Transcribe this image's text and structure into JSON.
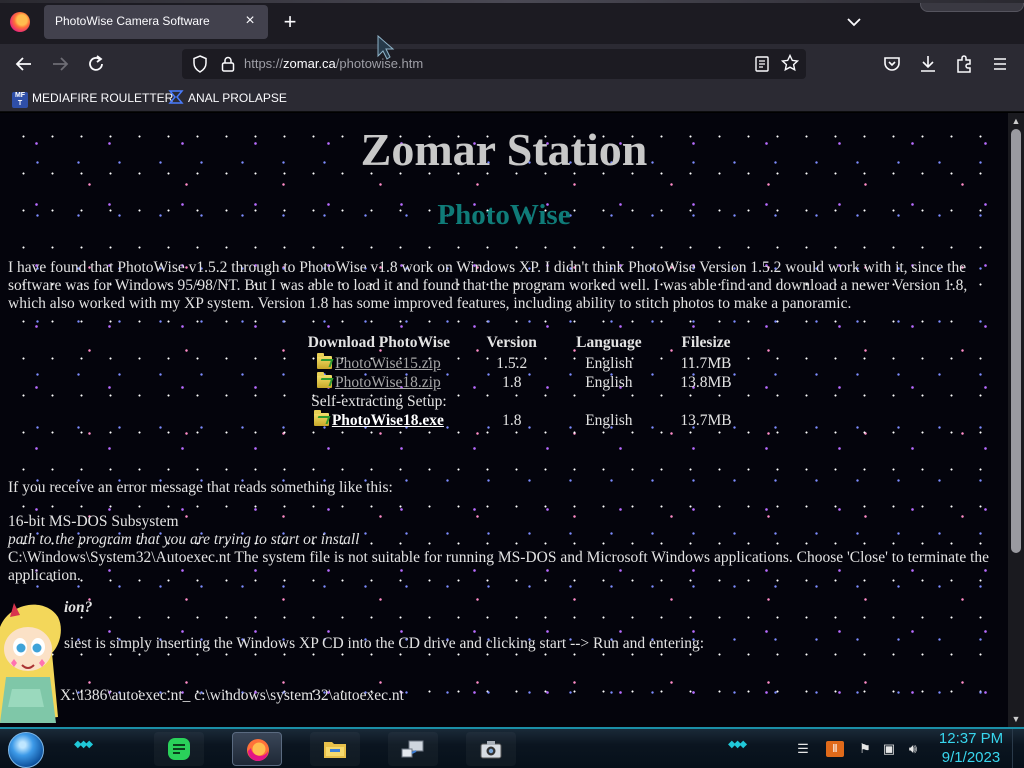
{
  "browser": {
    "tab_title": "PhotoWise Camera Software",
    "tab_close": "×",
    "new_tab": "+",
    "url_scheme": "https://",
    "url_host": "zomar.ca",
    "url_path": "/photowise.htm",
    "bookmarks": [
      {
        "label": "MEDIAFIRE ROULETTER",
        "icon": "mediafire-icon"
      },
      {
        "label": "ANAL PROLAPSE",
        "icon": "bookmark-site-icon"
      }
    ]
  },
  "page": {
    "site_title": "Zomar Station",
    "product_title": "PhotoWise",
    "intro": "I have found that PhotoWise v1.5.2 through to PhotoWise v1.8 work on Windows XP.  I didn't think PhotoWise Version 1.5.2 would work with it, since the software was for Windows 95/98/NT. But I was able to load it and found that the program worked well. I was able find and download a newer Version 1.8, which also worked with my XP system. Version 1.8 has some improved features, including ability to stitch photos to make a panoramic.",
    "table": {
      "headers": [
        "Download PhotoWise",
        "Version",
        "Language",
        "Filesize"
      ],
      "rows": [
        {
          "file": "PhotoWise15.zip",
          "version": "1.5.2",
          "language": "English",
          "size": "11.7MB"
        },
        {
          "file": "PhotoWise18.zip",
          "version": "1.8",
          "language": "English",
          "size": "13.8MB"
        }
      ],
      "section_label": "Self-extracting Setup:",
      "setup_row": {
        "file": "PhotoWise18.exe",
        "version": "1.8",
        "language": "English",
        "size": "13.7MB"
      }
    },
    "error_intro": "If you receive an error message that reads something like this:",
    "error_title": "16-bit MS-DOS Subsystem",
    "error_path": "path to the program that you are trying to start or install",
    "error_message": "C:\\Windows\\System32\\Autoexec.nt The system file is not suitable for running MS-DOS and Microsoft Windows applications. Choose 'Close' to terminate the application.",
    "question_partial": "ion?",
    "cd_partial": "siest is simply inserting the Windows XP CD into the CD drive and clicking start --> Run and entering:",
    "command_partial": "X:\\i386\\autoexec.nt_ c:\\windows\\system32\\autoexec.nt"
  },
  "taskbar": {
    "time": "12:37 PM",
    "date": "9/1/2023",
    "apps": [
      "notes-app-icon",
      "firefox-icon",
      "file-explorer-icon",
      "network-app-icon",
      "camera-app-icon"
    ]
  }
}
